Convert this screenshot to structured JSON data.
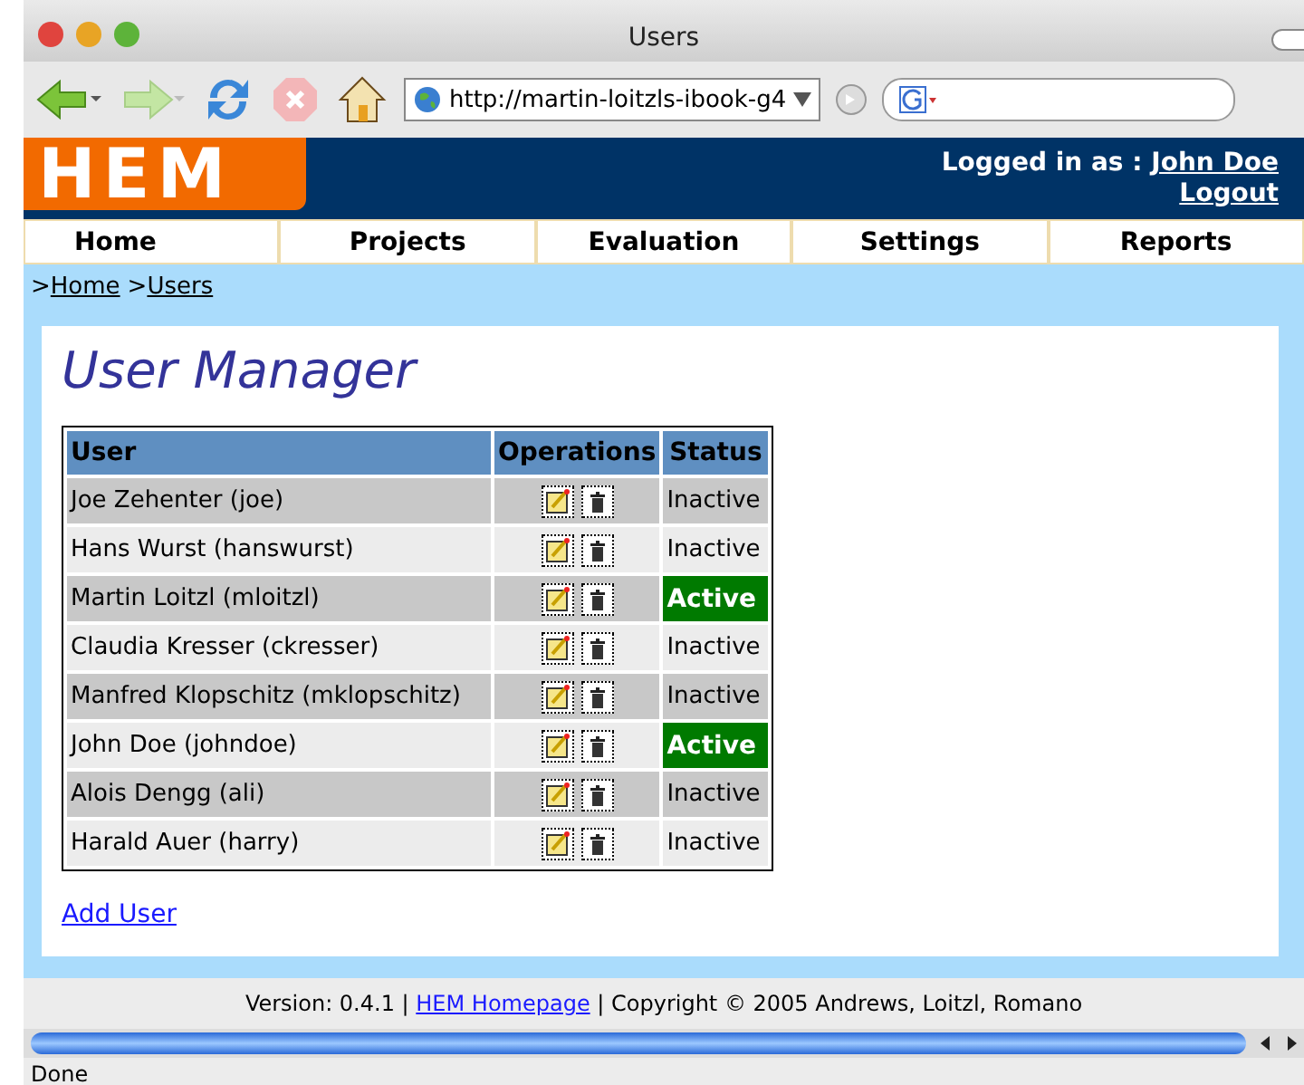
{
  "window": {
    "title": "Users"
  },
  "toolbar": {
    "url": "http://martin-loitzls-ibook-g4"
  },
  "header": {
    "logo": "HEM",
    "logged_in_label": "Logged in as :",
    "user": "John Doe",
    "logout": "Logout"
  },
  "nav": [
    "Home",
    "Projects",
    "Evaluation",
    "Settings",
    "Reports"
  ],
  "breadcrumb": [
    {
      "prefix": ">",
      "label": "Home"
    },
    {
      "prefix": ">",
      "label": "Users"
    }
  ],
  "page_title": "User Manager",
  "table": {
    "columns": [
      "User",
      "Operations",
      "Status"
    ],
    "rows": [
      {
        "user": "Joe Zehenter (joe)",
        "status": "Inactive",
        "active": false
      },
      {
        "user": "Hans Wurst (hanswurst)",
        "status": "Inactive",
        "active": false
      },
      {
        "user": "Martin Loitzl (mloitzl)",
        "status": "Active",
        "active": true
      },
      {
        "user": "Claudia Kresser (ckresser)",
        "status": "Inactive",
        "active": false
      },
      {
        "user": "Manfred Klopschitz (mklopschitz)",
        "status": "Inactive",
        "active": false
      },
      {
        "user": "John Doe (johndoe)",
        "status": "Active",
        "active": true
      },
      {
        "user": "Alois Dengg (ali)",
        "status": "Inactive",
        "active": false
      },
      {
        "user": "Harald Auer (harry)",
        "status": "Inactive",
        "active": false
      }
    ]
  },
  "add_user": "Add User",
  "footer": {
    "before": "Version: 0.4.1 |",
    "link": "HEM Homepage",
    "after": "| Copyright © 2005 Andrews, Loitzl, Romano"
  },
  "status_bar": "Done"
}
